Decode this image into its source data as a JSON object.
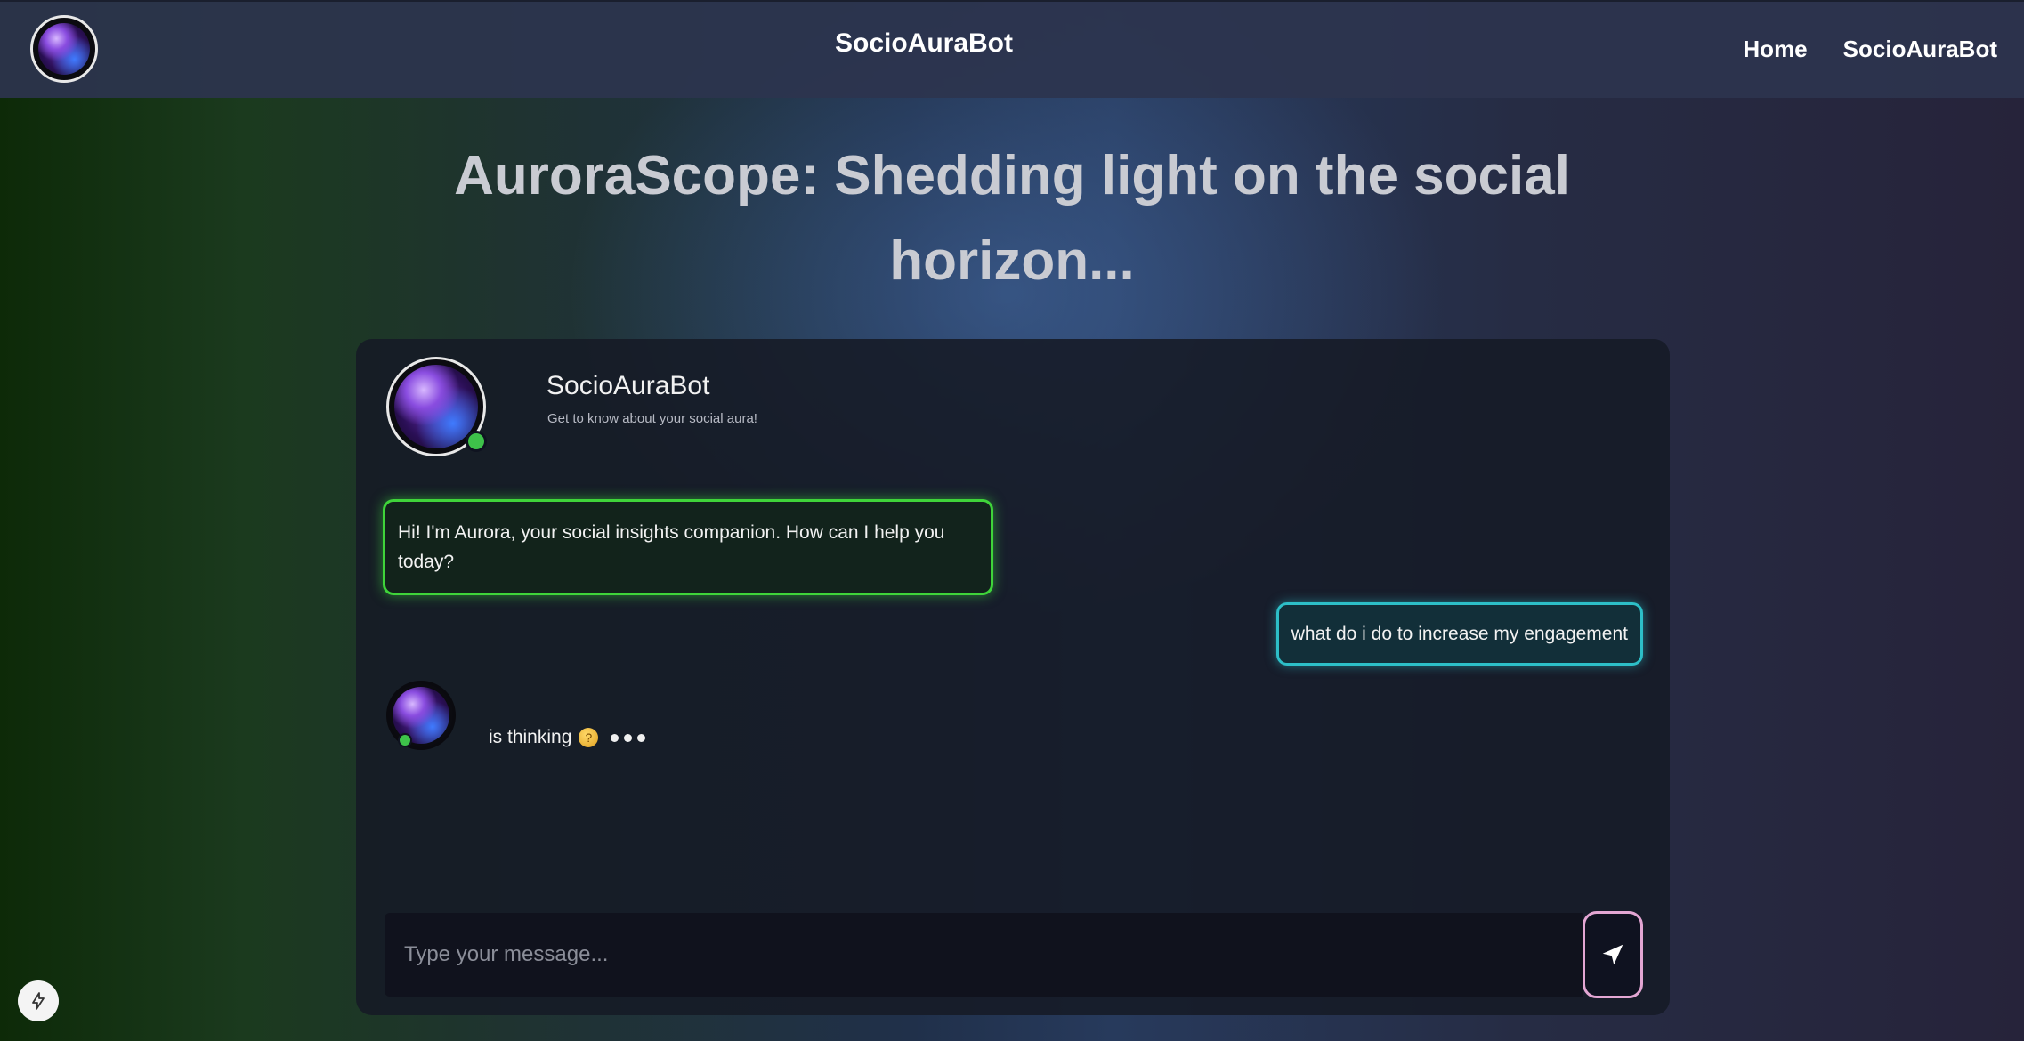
{
  "navbar": {
    "title": "SocioAuraBot",
    "links": [
      "Home",
      "SocioAuraBot"
    ],
    "logo_icon": "aura-orb-icon"
  },
  "headline": "AuroraScope: Shedding light on the social horizon...",
  "chat": {
    "bot_name": "SocioAuraBot",
    "bot_tagline": "Get to know about your social aura!",
    "status": "online",
    "messages": [
      {
        "sender": "bot",
        "text": "Hi! I'm Aurora, your social insights companion. How can I help you today?"
      },
      {
        "sender": "user",
        "text": "what do i do to increase my engagement"
      }
    ],
    "thinking_text": "is thinking",
    "thinking_icon": "thinking-face-icon",
    "input_placeholder": "Type your message...",
    "send_icon": "send-arrow-icon"
  },
  "floating_button_icon": "lightning-bolt-icon",
  "colors": {
    "bot_bubble_border": "#3fd43a",
    "user_bubble_border": "#2dbfc8",
    "send_button_border": "#e3a6d3",
    "online_dot": "#3ec24a"
  }
}
